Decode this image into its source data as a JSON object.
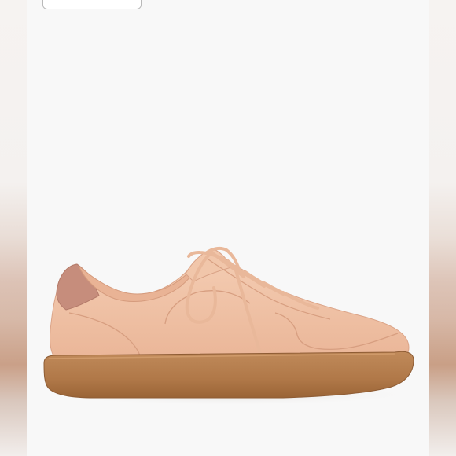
{
  "image": {
    "subject": "sneaker-photo",
    "colors": {
      "upper": "#f0c3a6",
      "upper_shadow": "#dea889",
      "heel_tab": "#c58c7c",
      "sole": "#b47c4c",
      "sole_dark": "#8e5c34",
      "laces": "#ecbfa2",
      "background": "#f8f8f8"
    }
  }
}
